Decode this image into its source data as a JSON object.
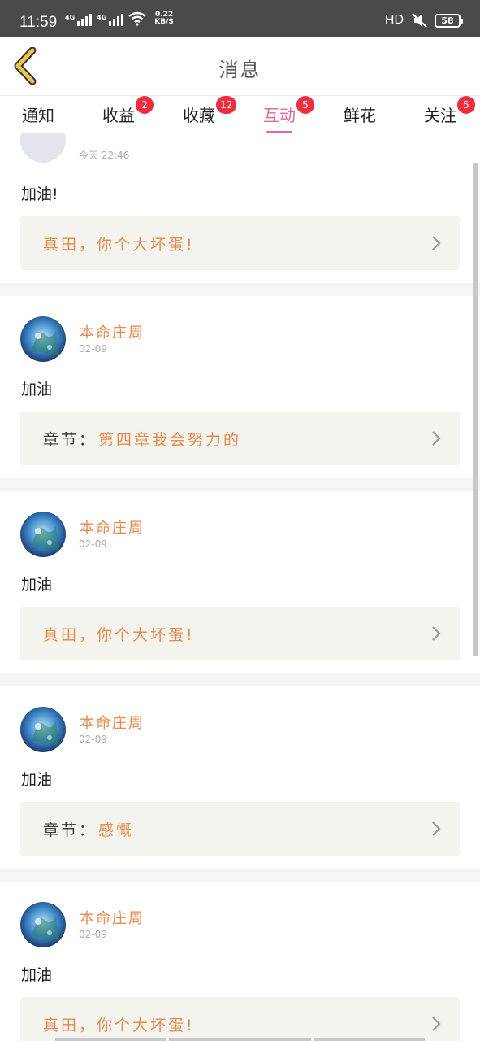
{
  "status_bar": {
    "time": "11:59",
    "network_label_1": "4G",
    "network_label_2": "4G",
    "speed_value": "0.22",
    "speed_unit": "KB/S",
    "hd_label": "HD",
    "battery": "58"
  },
  "header": {
    "title": "消息"
  },
  "tabs": [
    {
      "label": "通知",
      "badge": ""
    },
    {
      "label": "收益",
      "badge": "2"
    },
    {
      "label": "收藏",
      "badge": "12"
    },
    {
      "label": "互动",
      "badge": "5"
    },
    {
      "label": "鲜花",
      "badge": ""
    },
    {
      "label": "关注",
      "badge": "5"
    }
  ],
  "active_tab": "互动",
  "messages": [
    {
      "author": "",
      "date": "今天 22:46",
      "comment": "加油!",
      "ref_prefix": "",
      "ref_text": "真田，你个大坏蛋!"
    },
    {
      "author": "本命庄周",
      "date": "02-09",
      "comment": "加油",
      "ref_prefix": "章节：",
      "ref_text": "第四章我会努力的"
    },
    {
      "author": "本命庄周",
      "date": "02-09",
      "comment": "加油",
      "ref_prefix": "",
      "ref_text": "真田，你个大坏蛋!"
    },
    {
      "author": "本命庄周",
      "date": "02-09",
      "comment": "加油",
      "ref_prefix": "章节：",
      "ref_text": "感慨"
    },
    {
      "author": "本命庄周",
      "date": "02-09",
      "comment": "加油",
      "ref_prefix": "",
      "ref_text": "真田，你个大坏蛋!"
    }
  ],
  "colors": {
    "accent_pink": "#e5679c",
    "author_orange": "#e58a4e",
    "badge_red": "#ef2f3f",
    "ref_box_bg": "#f4f4ee",
    "back_arrow": "#e8c84a"
  },
  "icons": {
    "back": "back-arrow-icon",
    "chevron": "chevron-right-icon",
    "wifi": "wifi-icon",
    "mute": "mute-icon",
    "battery": "battery-icon"
  }
}
